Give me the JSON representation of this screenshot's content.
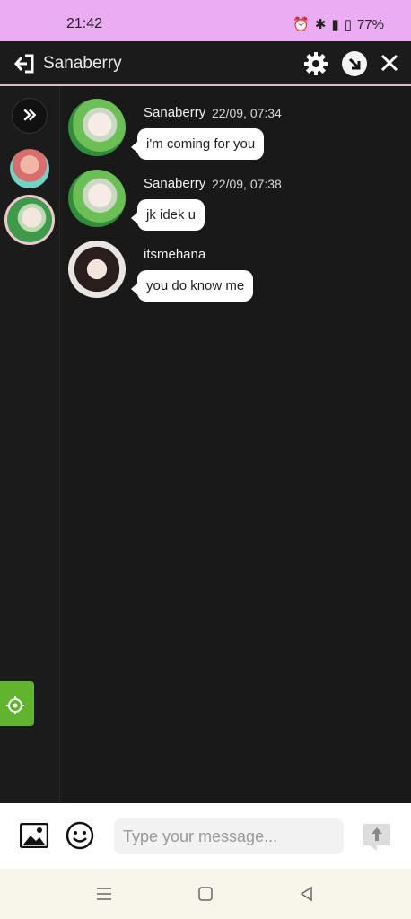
{
  "status": {
    "time": "21:42",
    "battery": "77%"
  },
  "header": {
    "title": "Sanaberry"
  },
  "messages": [
    {
      "user": "Sanaberry",
      "time": "22/09, 07:34",
      "text": "i'm coming for you"
    },
    {
      "user": "Sanaberry",
      "time": "22/09, 07:38",
      "text": "jk idek u"
    },
    {
      "user": "itsmehana",
      "time": "",
      "text": "you do know me"
    }
  ],
  "composer": {
    "placeholder": "Type your message..."
  },
  "colors": {
    "status_bar": "#ecacf4",
    "settings_tab": "#5fb62e",
    "accent_border": "#e6b7c7"
  },
  "icons": {
    "exit": "exit-icon",
    "settings": "gear-icon",
    "minimize": "minimize-icon",
    "close": "close-icon",
    "expand": "chevron-double-right-icon",
    "settings_tab": "gear-icon",
    "image": "image-icon",
    "emoji": "emoji-icon",
    "send": "send-icon"
  }
}
